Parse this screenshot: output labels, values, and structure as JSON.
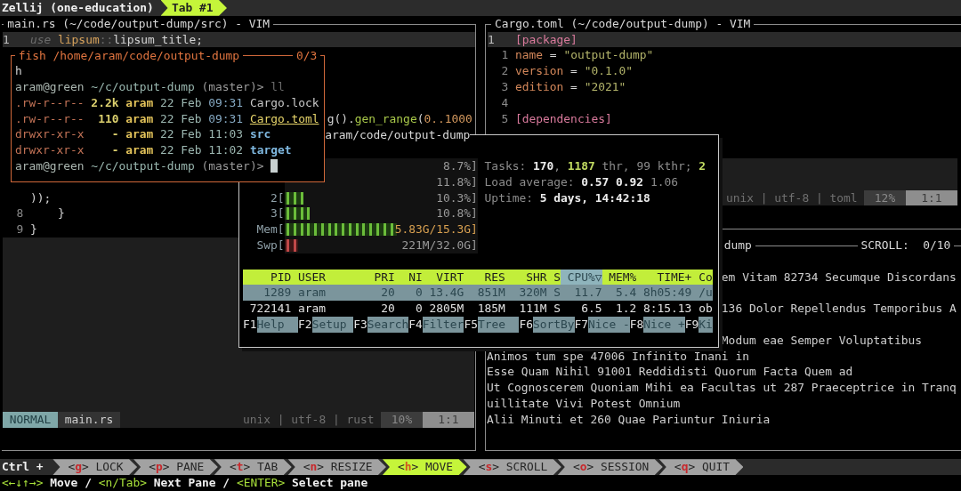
{
  "top_bar": {
    "session": "Zellij (one-education)",
    "tabs": [
      {
        "label": "Tab #1",
        "selected": true
      }
    ]
  },
  "main_editor": {
    "title": "main.rs (~/code/output-dump/src) - VIM",
    "lines": [
      {
        "number": "1",
        "current": true,
        "segments": [
          {
            "text": "use",
            "kind": "keyword"
          },
          {
            "text": " lipsum",
            "kind": "module"
          },
          {
            "text": "::",
            "kind": "punct"
          },
          {
            "text": "lipsum_title;"
          }
        ]
      },
      {
        "current": false,
        "segments": [
          {
            "text": "g()."
          },
          {
            "text": "gen_range",
            "kind": "function"
          },
          {
            "text": "("
          },
          {
            "text": "0..1000",
            "kind": "number"
          }
        ]
      },
      {
        "current": false,
        "segments": [
          {
            "text": "));"
          }
        ]
      },
      {
        "number": "8",
        "current": false,
        "segments": [
          {
            "text": "    }"
          }
        ]
      },
      {
        "number": "9",
        "current": false,
        "segments": [
          {
            "text": "}"
          }
        ]
      }
    ],
    "status": {
      "mode": "NORMAL",
      "file": "main.rs",
      "info": "unix | utf-8 | rust",
      "percent": "10%",
      "position": "1:1"
    }
  },
  "cargo_editor": {
    "title": "Cargo.toml (~/code/output-dump) - VIM",
    "lines": [
      {
        "number": "1",
        "current": true,
        "segments": [
          {
            "text": "[package]",
            "kind": "section"
          }
        ]
      },
      {
        "number": "1",
        "current": false,
        "segments": [
          {
            "text": "name",
            "kind": "key"
          },
          {
            "text": " = "
          },
          {
            "text": "\"output-dump\"",
            "kind": "string"
          }
        ]
      },
      {
        "number": "2",
        "current": false,
        "segments": [
          {
            "text": "version",
            "kind": "key"
          },
          {
            "text": " = "
          },
          {
            "text": "\"0.1.0\"",
            "kind": "string"
          }
        ]
      },
      {
        "number": "3",
        "current": false,
        "segments": [
          {
            "text": "edition",
            "kind": "key"
          },
          {
            "text": " = "
          },
          {
            "text": "\"2021\"",
            "kind": "string"
          }
        ]
      },
      {
        "number": "4",
        "current": false
      },
      {
        "number": "5",
        "current": false,
        "segments": [
          {
            "text": "[dependencies]",
            "kind": "section"
          }
        ]
      }
    ],
    "status": {
      "info": "unix | utf-8 | toml",
      "percent": "12%",
      "position": "1:1"
    }
  },
  "fish": {
    "title": "fish /home/aram/code/output-dump",
    "counter": "0/3",
    "lines": [
      {
        "segments": [
          {
            "text": "h"
          }
        ]
      },
      {
        "segments": [
          {
            "text": "aram@green",
            "kind": "user"
          },
          {
            "text": " ~/c/output-dump",
            "kind": "path"
          },
          {
            "text": " (master)>",
            "kind": "branch"
          },
          {
            "text": " ll",
            "kind": "command"
          }
        ]
      },
      {
        "segments": [
          {
            "text": ".rw-r--r--",
            "kind": "perm"
          },
          {
            "text": " 2.2k",
            "kind": "size"
          },
          {
            "text": " aram",
            "kind": "owner"
          },
          {
            "text": " 22 Feb",
            "kind": "date"
          },
          {
            "text": " 09:31",
            "kind": "time"
          },
          {
            "text": " Cargo.lock",
            "kind": "file"
          }
        ]
      },
      {
        "segments": [
          {
            "text": ".rw-r--r--",
            "kind": "perm"
          },
          {
            "text": "  110",
            "kind": "size"
          },
          {
            "text": " aram",
            "kind": "owner"
          },
          {
            "text": " 22 Feb",
            "kind": "date"
          },
          {
            "text": " 09:31 ",
            "kind": "time"
          },
          {
            "text": "Cargo.toml",
            "kind": "highlight"
          }
        ]
      },
      {
        "segments": [
          {
            "text": "drwxr-xr-x",
            "kind": "perm"
          },
          {
            "text": "    -",
            "kind": "size"
          },
          {
            "text": " aram",
            "kind": "owner"
          },
          {
            "text": " 22 Feb",
            "kind": "date"
          },
          {
            "text": " 11:03",
            "kind": "date"
          },
          {
            "text": " src",
            "kind": "dir"
          }
        ]
      },
      {
        "segments": [
          {
            "text": "drwxr-xr-x",
            "kind": "perm"
          },
          {
            "text": "    -",
            "kind": "size"
          },
          {
            "text": " aram",
            "kind": "owner"
          },
          {
            "text": " 22 Feb",
            "kind": "date"
          },
          {
            "text": " 11:02",
            "kind": "date"
          },
          {
            "text": " target",
            "kind": "dir"
          }
        ]
      },
      {
        "cursor": true,
        "segments": [
          {
            "text": "aram@green",
            "kind": "user"
          },
          {
            "text": " ~/c/output-dump",
            "kind": "path"
          },
          {
            "text": " (master)> ",
            "kind": "branch"
          }
        ]
      }
    ]
  },
  "htop": {
    "title": "aram/code/output-dump",
    "meters": [
      {
        "kind": "cpu",
        "value": "8.7%]"
      },
      {
        "kind": "cpu",
        "value": "11.8%]"
      },
      {
        "kind": "cpu",
        "label": "2[",
        "level": 0.1,
        "value": "10.3%]"
      },
      {
        "kind": "cpu",
        "label": "3[",
        "level": 0.13,
        "value": "10.8%]"
      },
      {
        "kind": "mem",
        "label": "Mem[",
        "level": 0.58,
        "value": "5.83G/15.3G]"
      },
      {
        "kind": "swap",
        "label": "Swp[",
        "level": 0.07,
        "value": "221M/32.0G]"
      }
    ],
    "info": [
      {
        "segments": [
          {
            "text": "Tasks: ",
            "kind": "label"
          },
          {
            "text": "170",
            "kind": "value"
          },
          {
            "text": ", ",
            "kind": "label"
          },
          {
            "text": "1187",
            "kind": "accent"
          },
          {
            "text": " thr, 99 kthr; ",
            "kind": "label"
          },
          {
            "text": "2",
            "kind": "accent"
          }
        ]
      },
      {
        "segments": [
          {
            "text": "Load average: ",
            "kind": "label"
          },
          {
            "text": "0.57 0.92",
            "kind": "value"
          },
          {
            "text": " 1.06",
            "kind": "label"
          }
        ]
      },
      {
        "segments": [
          {
            "text": "Uptime: ",
            "kind": "label"
          },
          {
            "text": "5 days, 14:42:18",
            "kind": "value"
          }
        ]
      }
    ],
    "columns": [
      {
        "label": "PID",
        "selected": false
      },
      {
        "label": "USER",
        "selected": false
      },
      {
        "label": "PRI",
        "selected": false
      },
      {
        "label": "NI",
        "selected": false
      },
      {
        "label": "VIRT",
        "selected": false
      },
      {
        "label": "RES",
        "selected": false
      },
      {
        "label": "SHR",
        "selected": false
      },
      {
        "label": "S",
        "selected": false
      },
      {
        "label": "CPU%▽",
        "selected": true
      },
      {
        "label": "MEM%",
        "selected": false
      },
      {
        "label": "TIME+",
        "selected": false
      },
      {
        "label": "Co",
        "selected": false
      }
    ],
    "rows": [
      {
        "selected": true,
        "cells": [
          "1289",
          "aram",
          "20",
          "0",
          "13.4G",
          "851M",
          "320M",
          "S",
          "11.7",
          "5.4",
          "8h05:49",
          "/u"
        ]
      },
      {
        "selected": false,
        "cells": [
          "722141",
          "aram",
          "20",
          "0",
          "2805M",
          "185M",
          "111M",
          "S",
          "6.5",
          "1.2",
          "8:15.13",
          "ob"
        ]
      }
    ],
    "function_keys": [
      {
        "key": "F1",
        "label": "Help"
      },
      {
        "key": "F2",
        "label": "Setup"
      },
      {
        "key": "F3",
        "label": "Search"
      },
      {
        "key": "F4",
        "label": "Filter"
      },
      {
        "key": "F5",
        "label": "Tree"
      },
      {
        "key": "F6",
        "label": "SortBy"
      },
      {
        "key": "F7",
        "label": "Nice -"
      },
      {
        "key": "F8",
        "label": "Nice +"
      },
      {
        "key": "F9",
        "label": "Ki"
      }
    ]
  },
  "scroll_pane": {
    "title": "dump",
    "scroll": "SCROLL:  0/10",
    "lines": [
      "em Vitam 82734 Secumque Discordans",
      "136 Dolor Repellendus Temporibus A",
      "Modum eae Semper Voluptatibus",
      "Animos tum spe 47006 Infinito Inani in",
      "Esse Quam Nihil 91001 Reddidisti Quorum Facta Quem ad",
      "Ut Cognoscerem Quoniam Mihi ea Facultas ut 287 Praeceptrice in Tranq",
      "uillitate Vivi Potest Omnium",
      "Alii Minuti et 260 Quae Pariuntur Iniuria"
    ]
  },
  "keybindings": {
    "modifier": "Ctrl +",
    "modes": [
      {
        "open": "<",
        "key": "g",
        "close": ">",
        "label": "LOCK",
        "selected": false
      },
      {
        "open": "<",
        "key": "p",
        "close": ">",
        "label": "PANE",
        "selected": false
      },
      {
        "open": "<",
        "key": "t",
        "close": ">",
        "label": "TAB",
        "selected": false
      },
      {
        "open": "<",
        "key": "n",
        "close": ">",
        "label": "RESIZE",
        "selected": false
      },
      {
        "open": "<",
        "key": "h",
        "close": ">",
        "label": "MOVE",
        "selected": true
      },
      {
        "open": "<",
        "key": "s",
        "close": ">",
        "label": "SCROLL",
        "selected": false
      },
      {
        "open": "<",
        "key": "o",
        "close": ">",
        "label": "SESSION",
        "selected": false
      },
      {
        "open": "<",
        "key": "q",
        "close": ">",
        "label": "QUIT",
        "selected": false
      }
    ]
  },
  "hint": {
    "segments": [
      {
        "text": "<←↓↑→>",
        "kind": "key"
      },
      {
        "text": " Move / "
      },
      {
        "text": "<n/Tab>",
        "kind": "key"
      },
      {
        "text": " Next Pane / "
      },
      {
        "text": "<ENTER>",
        "kind": "key"
      },
      {
        "text": " Select pane"
      }
    ]
  }
}
